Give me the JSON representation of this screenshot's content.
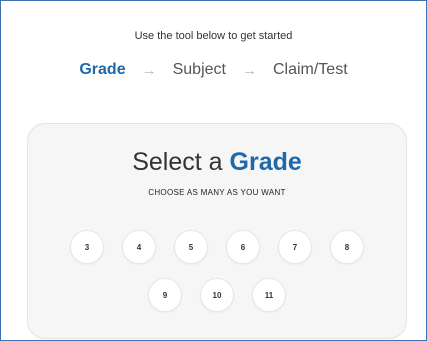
{
  "intro_text": "Use the tool below to get started",
  "steps": [
    {
      "label": "Grade",
      "active": true
    },
    {
      "label": "Subject",
      "active": false
    },
    {
      "label": "Claim/Test",
      "active": false
    }
  ],
  "arrow_glyph": "→",
  "card": {
    "title_prefix": "Select a",
    "title_strong": "Grade",
    "subtitle": "CHOOSE AS MANY AS YOU WANT"
  },
  "grades_row1": [
    "3",
    "4",
    "5",
    "6",
    "7",
    "8"
  ],
  "grades_row2": [
    "9",
    "10",
    "11"
  ],
  "colors": {
    "accent": "#1f68aa",
    "frame_border": "#3f6fb5",
    "card_background": "#f6f6f6"
  }
}
